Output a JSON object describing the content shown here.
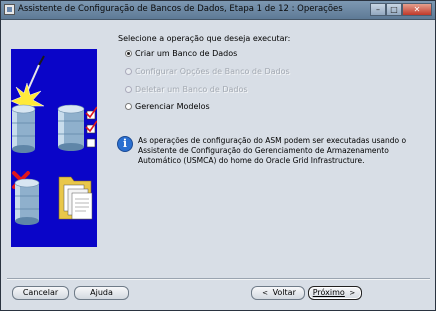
{
  "window": {
    "title": "Assistente de Configuração de Bancos de Dados, Etapa 1 de 12 : Operações",
    "controls": {
      "minimize": "–",
      "maximize": "□",
      "close": "✕"
    }
  },
  "main": {
    "prompt": "Selecione a operação que deseja executar:",
    "options": [
      {
        "label": "Criar um Banco de Dados",
        "selected": true,
        "enabled": true
      },
      {
        "label": "Configurar Opções de Banco de Dados",
        "selected": false,
        "enabled": false
      },
      {
        "label": "Deletar um Banco de Dados",
        "selected": false,
        "enabled": false
      },
      {
        "label": "Gerenciar Modelos",
        "selected": false,
        "enabled": true
      }
    ],
    "info": {
      "icon": "info-icon",
      "icon_glyph": "i",
      "text": "As operações de configuração do ASM podem ser executadas usando o Assistente de Configuração do Gerenciamento de Armazenamento Automático (USMCA) do home do Oracle Grid Infrastructure."
    }
  },
  "footer": {
    "cancel": "Cancelar",
    "help": "Ajuda",
    "back": "Voltar",
    "back_icon": "<",
    "next": "Próximo",
    "next_icon": ">"
  },
  "colors": {
    "illustration_background": "#0a05c8",
    "window_background": "#d8dee6",
    "info_icon": "#2a6fd0"
  }
}
